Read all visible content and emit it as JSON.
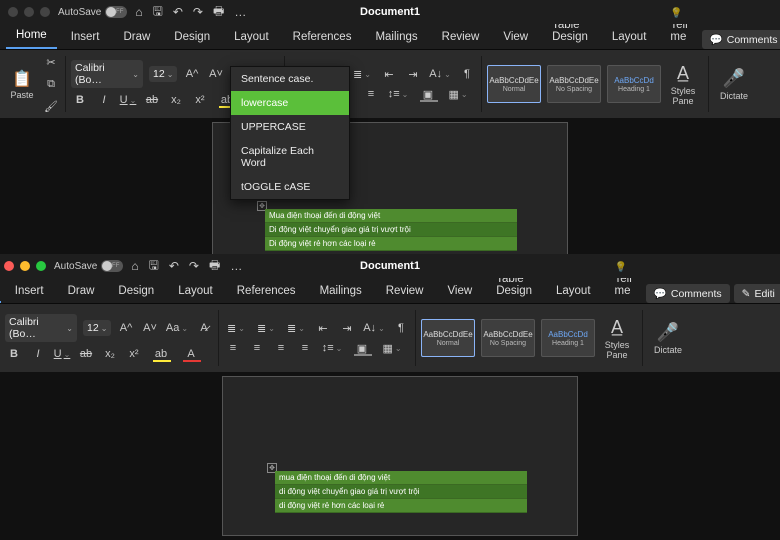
{
  "doc_title": "Document1",
  "autosave_label": "AutoSave",
  "autosave_state": "OFF",
  "tabs": [
    "Home",
    "Insert",
    "Draw",
    "Design",
    "Layout",
    "References",
    "Mailings",
    "Review",
    "View",
    "Table Design",
    "Layout"
  ],
  "tellme": "Tell me",
  "comments_btn": "Comments",
  "editing_btn": "Editing",
  "font_name": "Calibri (Bo…",
  "font_size": "12",
  "paste_label": "Paste",
  "styles": [
    {
      "sample": "AaBbCcDdEe",
      "label": "Normal"
    },
    {
      "sample": "AaBbCcDdEe",
      "label": "No Spacing"
    },
    {
      "sample": "AaBbCcDd",
      "label": "Heading 1"
    }
  ],
  "styles_pane": "Styles\nPane",
  "dictate": "Dictate",
  "case_menu": {
    "items": [
      "Sentence case.",
      "lowercase",
      "UPPERCASE",
      "Capitalize Each Word",
      "tOGGLE cASE"
    ],
    "hover_index": 1
  },
  "table_before": [
    "Mua điện thoại đến di động việt",
    "Di động việt chuyển giao giá trị vượt trội",
    "Di động việt rẻ hơn các loại rẻ"
  ],
  "table_after": [
    "mua điện thoại đến di động việt",
    "di động việt chuyển giao giá trị vượt trội",
    "di động việt rẻ hơn các loại rẻ"
  ],
  "icons": {
    "bold": "B",
    "italic": "I",
    "underline": "U",
    "strike": "ab",
    "sub": "x₂",
    "sup": "x²",
    "change_case": "Aa",
    "clear_fmt": "A",
    "font_color": "A",
    "highlight": "ab"
  }
}
